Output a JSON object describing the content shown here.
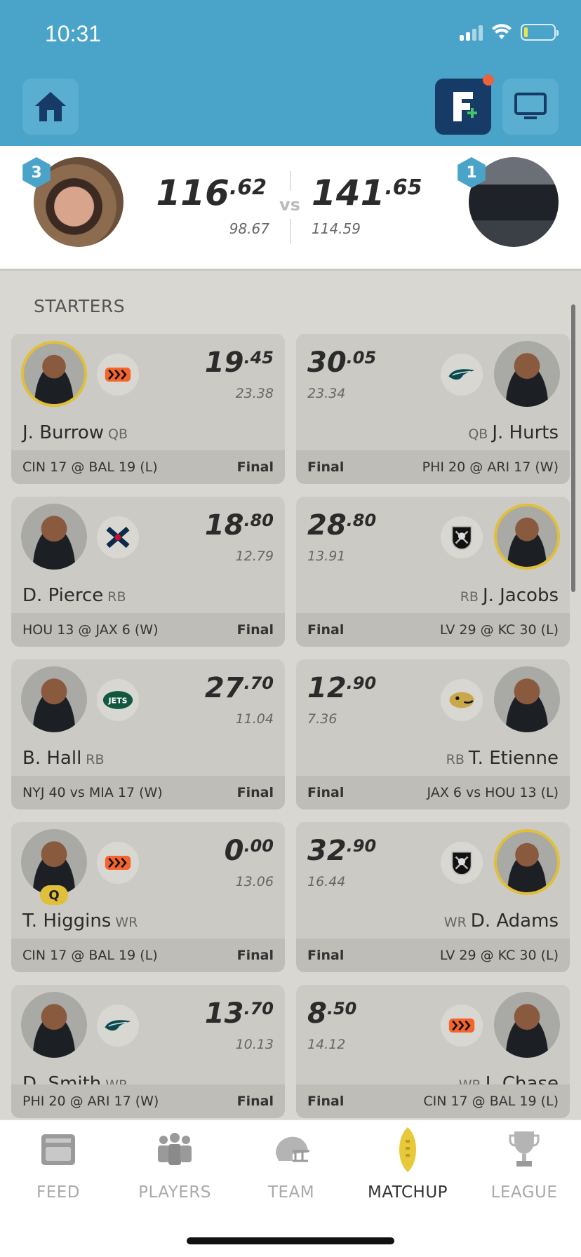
{
  "status": {
    "time": "10:31"
  },
  "matchup": {
    "left": {
      "rank": "3",
      "score_int": "116",
      "score_dec": ".62",
      "proj": "98.67"
    },
    "vs": "vs",
    "right": {
      "rank": "1",
      "score_int": "141",
      "score_dec": ".65",
      "proj": "114.59"
    }
  },
  "section_title": "STARTERS",
  "cards": [
    {
      "name": "J. Burrow",
      "pos": "QB",
      "pts_int": "19",
      "pts_dec": ".45",
      "proj": "23.38",
      "game": "CIN 17 @ BAL 19 (L)",
      "status": "Final",
      "team": "CIN"
    },
    {
      "name": "J. Hurts",
      "pos": "QB",
      "pts_int": "30",
      "pts_dec": ".05",
      "proj": "23.34",
      "game": "PHI 20 @ ARI 17 (W)",
      "status": "Final",
      "team": "PHI"
    },
    {
      "name": "D. Pierce",
      "pos": "RB",
      "pts_int": "18",
      "pts_dec": ".80",
      "proj": "12.79",
      "game": "HOU 13 @ JAX 6 (W)",
      "status": "Final",
      "team": "HOU"
    },
    {
      "name": "J. Jacobs",
      "pos": "RB",
      "pts_int": "28",
      "pts_dec": ".80",
      "proj": "13.91",
      "game": "LV 29 @ KC 30 (L)",
      "status": "Final",
      "team": "LV"
    },
    {
      "name": "B. Hall",
      "pos": "RB",
      "pts_int": "27",
      "pts_dec": ".70",
      "proj": "11.04",
      "game": "NYJ 40 vs MIA 17 (W)",
      "status": "Final",
      "team": "NYJ"
    },
    {
      "name": "T. Etienne",
      "pos": "RB",
      "pts_int": "12",
      "pts_dec": ".90",
      "proj": "7.36",
      "game": "JAX 6 vs HOU 13 (L)",
      "status": "Final",
      "team": "JAX"
    },
    {
      "name": "T. Higgins",
      "pos": "WR",
      "pts_int": "0",
      "pts_dec": ".00",
      "proj": "13.06",
      "game": "CIN 17 @ BAL 19 (L)",
      "status": "Final",
      "team": "CIN",
      "badge": "Q"
    },
    {
      "name": "D. Adams",
      "pos": "WR",
      "pts_int": "32",
      "pts_dec": ".90",
      "proj": "16.44",
      "game": "LV 29 @ KC 30 (L)",
      "status": "Final",
      "team": "LV"
    },
    {
      "name": "D. Smith",
      "pos": "WR",
      "pts_int": "13",
      "pts_dec": ".70",
      "proj": "10.13",
      "game": "PHI 20 @ ARI 17 (W)",
      "status": "Final",
      "team": "PHI"
    },
    {
      "name": "J. Chase",
      "pos": "WR",
      "pts_int": "8",
      "pts_dec": ".50",
      "proj": "14.12",
      "game": "CIN 17 @ BAL 19 (L)",
      "status": "Final",
      "team": "CIN"
    }
  ],
  "tabs": [
    {
      "label": "FEED",
      "icon": "feed-icon"
    },
    {
      "label": "PLAYERS",
      "icon": "players-icon"
    },
    {
      "label": "TEAM",
      "icon": "helmet-icon"
    },
    {
      "label": "MATCHUP",
      "icon": "football-icon"
    },
    {
      "label": "LEAGUE",
      "icon": "trophy-icon"
    }
  ],
  "colors": {
    "header": "#4aa3c8",
    "gold": "#e0bf3a",
    "navy": "#173b67",
    "notification": "#e8643c"
  }
}
